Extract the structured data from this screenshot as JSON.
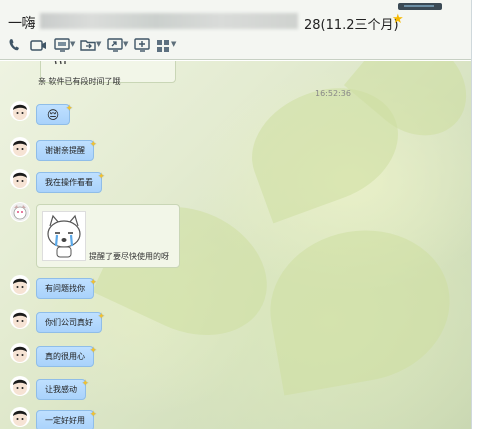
{
  "window": {
    "title_prefix": "一嗨",
    "title_suffix": "28(11.2三个月)",
    "vip_icon": "star-icon"
  },
  "toolbar": {
    "items": [
      {
        "name": "voice-call-icon"
      },
      {
        "name": "video-call-icon"
      },
      {
        "name": "remote-desktop-icon"
      },
      {
        "name": "file-transfer-icon"
      },
      {
        "name": "screen-share-icon"
      },
      {
        "name": "invite-icon"
      },
      {
        "name": "apps-grid-icon"
      }
    ]
  },
  "chat": {
    "first_message": "亲 软件已有段时间了哦",
    "timestamp": "16:52:36",
    "sticker_caption": "提醒了要尽快使用的呀",
    "messages": [
      {
        "text": "😔",
        "kind": "emoji"
      },
      {
        "text": "谢谢亲提醒"
      },
      {
        "text": "我在操作看看"
      },
      {
        "text": "有问题找你"
      },
      {
        "text": "你们公司真好"
      },
      {
        "text": "真的很用心"
      },
      {
        "text": "让我感动"
      },
      {
        "text": "一定好好用"
      }
    ]
  },
  "colors": {
    "outgoing_bubble": "#a9d2fb",
    "incoming_bubble": "#f2f6e8",
    "toolbar_bg": "#f4f6f2",
    "star": "#f5b800"
  }
}
